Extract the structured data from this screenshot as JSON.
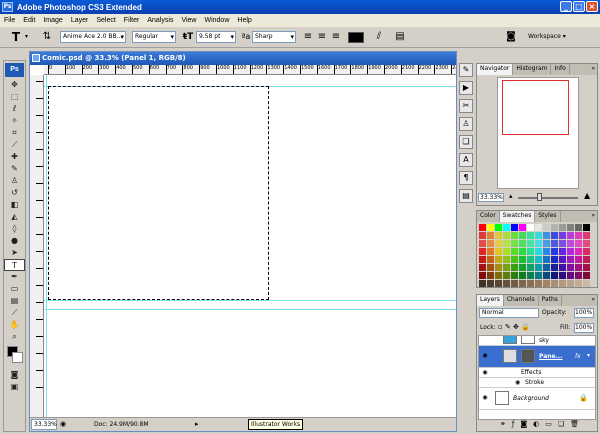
{
  "app": {
    "title": "Adobe Photoshop CS3 Extended",
    "logo": "Ps"
  },
  "menu": [
    "File",
    "Edit",
    "Image",
    "Layer",
    "Select",
    "Filter",
    "Analysis",
    "View",
    "Window",
    "Help"
  ],
  "options": {
    "font_family": "Anime Ace 2.0 BB...",
    "font_style": "Regular",
    "font_size": "9.58 pt",
    "antialias": "Sharp",
    "text_color": "#000000",
    "workspace": "Workspace ▾"
  },
  "document": {
    "title": "Comic.psd @ 33.3% (Panel 1, RGB/8)",
    "zoom": "33.33%",
    "doc_info": "Doc: 24.9M/90.8M",
    "tooltip": "Illustrator Works",
    "ruler_labels": [
      "0",
      "100",
      "200",
      "300",
      "400",
      "500",
      "600",
      "700",
      "800",
      "900",
      "1000",
      "1100",
      "1200",
      "1300",
      "1400",
      "1500",
      "1600",
      "1700",
      "1800",
      "1900",
      "2000",
      "2100",
      "2200",
      "2300",
      "2400"
    ]
  },
  "navigator": {
    "tabs": [
      "Navigator",
      "Histogram",
      "Info"
    ],
    "zoom": "33.33%",
    "zoom_level": 0.35
  },
  "swatches": {
    "tabs": [
      "Color",
      "Swatches",
      "Styles"
    ]
  },
  "layers": {
    "tabs": [
      "Layers",
      "Channels",
      "Paths"
    ],
    "blend_mode": "Normal",
    "opacity_label": "Opacity:",
    "opacity": "100%",
    "lock_label": "Lock:",
    "fill_label": "Fill:",
    "fill": "100%",
    "items": [
      {
        "name": "sky",
        "sub": false
      },
      {
        "name": "Pane...",
        "sub": false,
        "selected": true,
        "fx": "fx"
      },
      {
        "name": "Effects",
        "sub": true
      },
      {
        "name": "Stroke",
        "sub": true
      },
      {
        "name": "Background",
        "sub": false
      }
    ]
  },
  "colors": {
    "accent": "#0a4fc4",
    "selection": "#3a6fd0",
    "guide": "#7fe0f0",
    "nav_box": "#e23030"
  }
}
